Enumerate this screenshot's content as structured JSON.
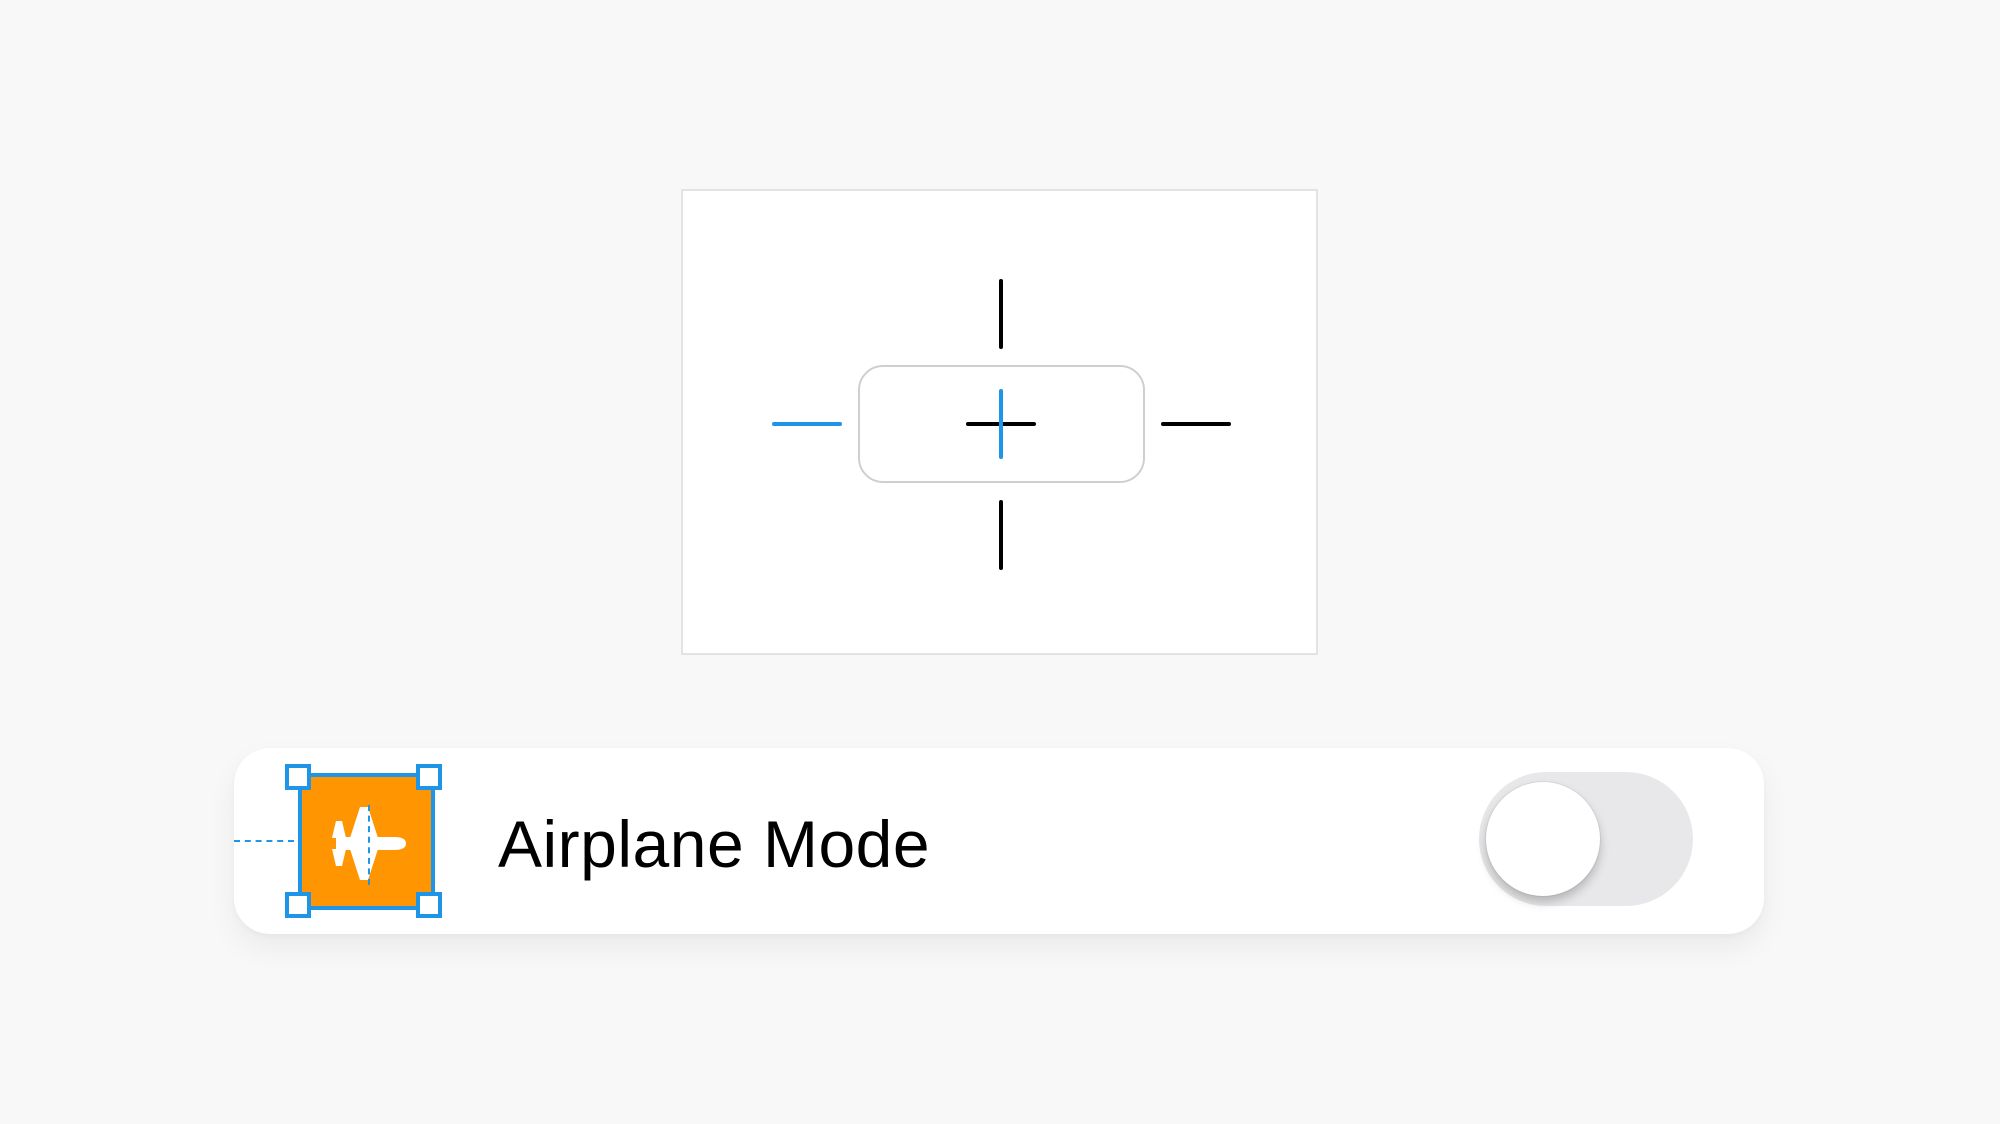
{
  "settings_row": {
    "label": "Airplane Mode",
    "icon": "airplane-icon",
    "toggle_on": false
  },
  "colors": {
    "background": "#f8f8f8",
    "accent_blue": "#1e95e6",
    "icon_orange": "#ff9500",
    "toggle_off_track": "#e8e8ea",
    "constraint_default": "#000000"
  }
}
